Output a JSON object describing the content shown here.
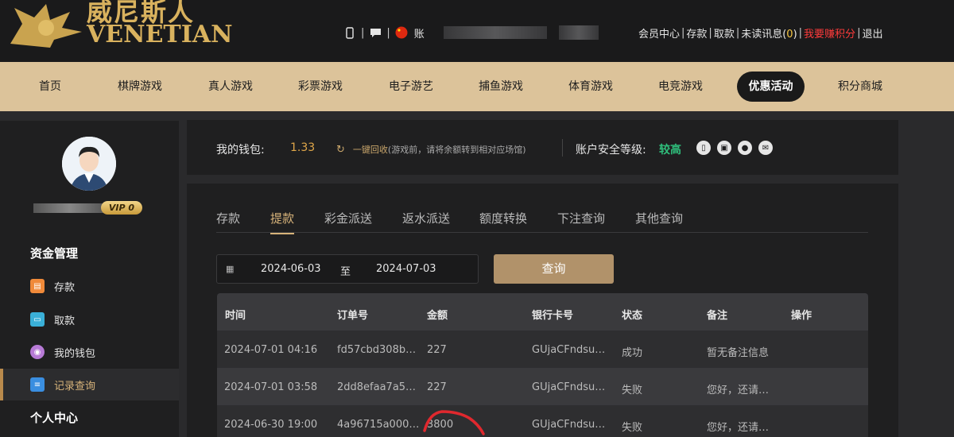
{
  "header": {
    "logo_cn": "威尼斯人",
    "logo_en": "VENETIAN",
    "account_prefix": "账",
    "links": {
      "member_center": "会员中心",
      "deposit": "存款",
      "withdraw": "取款",
      "unread_prefix": "未读讯息(",
      "unread_count": "0",
      "unread_suffix": ")",
      "earn_points": "我要赚积分",
      "logout": "退出"
    }
  },
  "nav": {
    "items": [
      "首页",
      "棋牌游戏",
      "真人游戏",
      "彩票游戏",
      "电子游艺",
      "捕鱼游戏",
      "体育游戏",
      "电竞游戏",
      "优惠活动",
      "积分商城"
    ],
    "active_index": 8
  },
  "sidebar": {
    "vip_label": "VIP 0",
    "funds_title": "资金管理",
    "items": [
      "存款",
      "取款",
      "我的钱包",
      "记录查询"
    ],
    "active_index": 3,
    "personal_title": "个人中心"
  },
  "wallet": {
    "label": "我的钱包:",
    "amount": "1.33",
    "recycle_label": "一键回收",
    "recycle_hint": "(游戏前，请将余额转到相对应场馆)",
    "security_label": "账户安全等级:",
    "security_level": "较高"
  },
  "tabs": {
    "items": [
      "存款",
      "提款",
      "彩金派送",
      "返水派送",
      "额度转换",
      "下注查询",
      "其他查询"
    ],
    "active_index": 1
  },
  "filter": {
    "date_from": "2024-06-03",
    "to_label": "至",
    "date_to": "2024-07-03",
    "query_button": "查询"
  },
  "table": {
    "headers": [
      "时间",
      "订单号",
      "金额",
      "银行卡号",
      "状态",
      "备注",
      "操作"
    ],
    "rows": [
      [
        "2024-07-01 04:16",
        "fd57cbd308b…",
        "227",
        "GUjaCFndsu…",
        "成功",
        "暂无备注信息",
        ""
      ],
      [
        "2024-07-01 03:58",
        "2dd8efaa7a5…",
        "227",
        "GUjaCFndsu…",
        "失败",
        "您好，还请…",
        ""
      ],
      [
        "2024-06-30 19:00",
        "4a96715a000…",
        "3800",
        "GUjaCFndsu…",
        "失败",
        "您好，还请…",
        ""
      ]
    ]
  },
  "colors": {
    "accent_gold": "#d7b37a",
    "nav_bg": "#dcc39a",
    "success_green": "#2fbe7b",
    "alert_red": "#ff3b3b"
  },
  "icons": {
    "phone": "phone-icon",
    "chat": "chat-icon",
    "flag": "china-flag-icon",
    "recycle": "refresh-icon"
  }
}
